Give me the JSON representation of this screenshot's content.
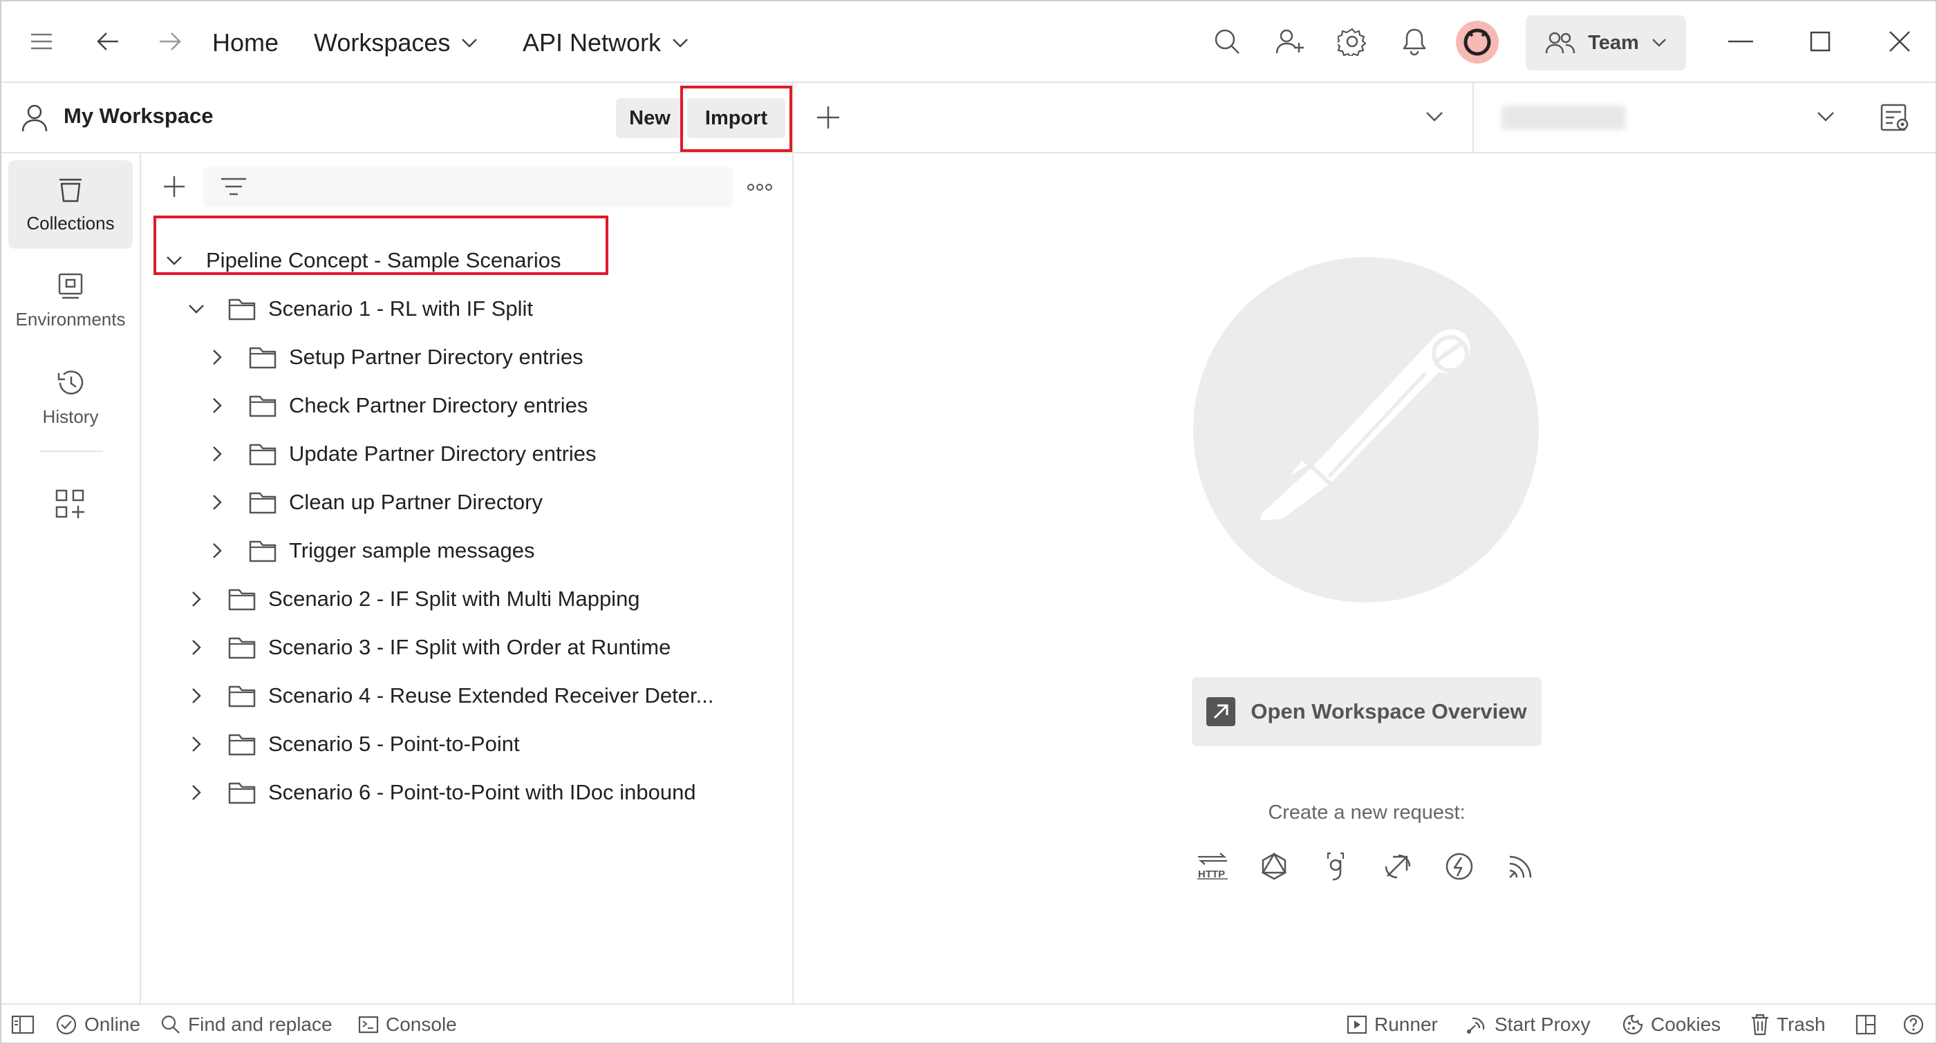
{
  "titlebar": {
    "home": "Home",
    "workspaces": "Workspaces",
    "api_network": "API Network",
    "team": "Team"
  },
  "workspace": {
    "title": "My Workspace",
    "new_label": "New",
    "import_label": "Import"
  },
  "rail": {
    "collections": "Collections",
    "environments": "Environments",
    "history": "History"
  },
  "tree": {
    "collection": "Pipeline Concept - Sample Scenarios",
    "scenario1": "Scenario 1 - RL with IF Split",
    "sub": [
      "Setup Partner Directory entries",
      "Check Partner Directory entries",
      "Update Partner Directory entries",
      "Clean up Partner Directory",
      "Trigger sample messages"
    ],
    "scenarios": [
      "Scenario 2 - IF Split with Multi Mapping",
      "Scenario 3 - IF Split with Order at Runtime",
      "Scenario 4 - Reuse Extended Receiver Deter...",
      "Scenario 5 - Point-to-Point",
      "Scenario 6 - Point-to-Point with IDoc inbound"
    ]
  },
  "main": {
    "open_overview": "Open Workspace Overview",
    "create_request": "Create a new request:",
    "http_label": "HTTP"
  },
  "status": {
    "online": "Online",
    "find_replace": "Find and replace",
    "console": "Console",
    "runner": "Runner",
    "start_proxy": "Start Proxy",
    "cookies": "Cookies",
    "trash": "Trash"
  },
  "colors": {
    "highlight": "#e0192a",
    "button_bg": "#ededed"
  }
}
